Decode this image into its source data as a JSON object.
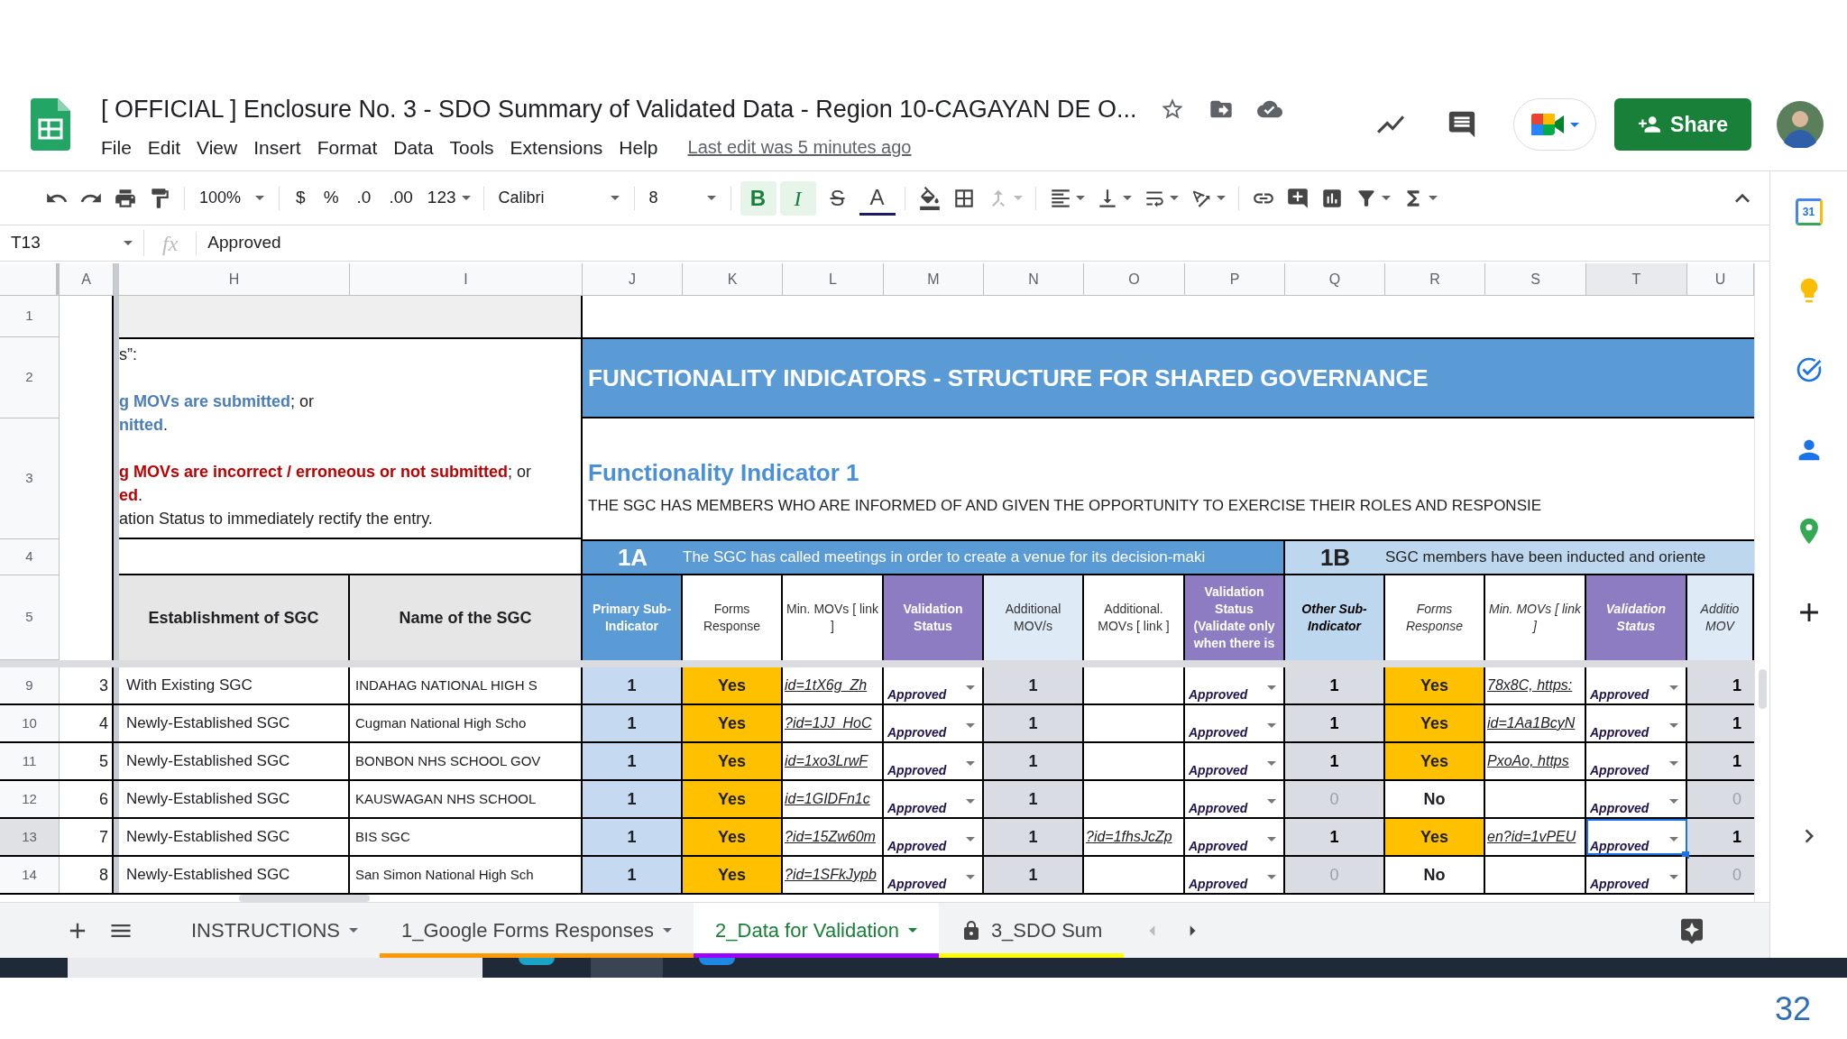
{
  "document": {
    "title": "[ OFFICIAL ] Enclosure No. 3 - SDO Summary of Validated Data - Region 10-CAGAYAN DE O...",
    "last_edit": "Last edit was 5 minutes ago",
    "share": "Share"
  },
  "menu": [
    "File",
    "Edit",
    "View",
    "Insert",
    "Format",
    "Data",
    "Tools",
    "Extensions",
    "Help"
  ],
  "toolbar": {
    "zoom": "100%",
    "currency": "$",
    "percent": "%",
    "decrease_decimals": ".0",
    "increase_decimals": ".00",
    "number_format": "123",
    "font": "Calibri",
    "font_size": "8",
    "styles": [
      {
        "kind": "bold",
        "label": "B",
        "on": true
      },
      {
        "kind": "italic",
        "label": "I",
        "on": true
      },
      {
        "kind": "strike",
        "label": "S",
        "on": false
      }
    ],
    "text_color": "A"
  },
  "formula_bar": {
    "cell": "T13",
    "label": "fx",
    "value": "Approved"
  },
  "columns": [
    {
      "label": "A",
      "selected": false
    },
    {
      "label": "H",
      "selected": false
    },
    {
      "label": "I",
      "selected": false
    },
    {
      "label": "J",
      "selected": false
    },
    {
      "label": "K",
      "selected": false
    },
    {
      "label": "L",
      "selected": false
    },
    {
      "label": "M",
      "selected": false
    },
    {
      "label": "N",
      "selected": false
    },
    {
      "label": "O",
      "selected": false
    },
    {
      "label": "P",
      "selected": false
    },
    {
      "label": "Q",
      "selected": false
    },
    {
      "label": "R",
      "selected": false
    },
    {
      "label": "S",
      "selected": false
    },
    {
      "label": "T",
      "selected": true
    },
    {
      "label": "U",
      "selected": false
    }
  ],
  "top_rows": [
    "1",
    "2",
    "3",
    "4",
    "5"
  ],
  "instructions": [
    {
      "lines": [
        [
          {
            "text": "s”:",
            "kind": "plain"
          }
        ]
      ]
    },
    {
      "lines": [
        [
          {
            "text": "g MOVs are submitted",
            "kind": "ok"
          },
          {
            "text": "; or",
            "kind": "plain"
          }
        ],
        [
          {
            "text": "nitted",
            "kind": "ok"
          },
          {
            "text": ".",
            "kind": "plain"
          }
        ]
      ]
    },
    {
      "lines": [
        [
          {
            "text": "g MOVs are incorrect / erroneous or not submitted",
            "kind": "error"
          },
          {
            "text": "; or",
            "kind": "plain"
          }
        ],
        [
          {
            "text": "ed",
            "kind": "error"
          },
          {
            "text": ".",
            "kind": "plain"
          }
        ],
        [
          {
            "text": "ation Status to immediately rectify the entry.",
            "kind": "plain"
          }
        ]
      ]
    }
  ],
  "banner": "FUNCTIONALITY INDICATORS - STRUCTURE FOR SHARED GOVERNANCE",
  "indicator": {
    "title": "Functionality Indicator 1",
    "description": "THE SGC HAS MEMBERS WHO ARE INFORMED OF AND GIVEN THE OPPORTUNITY TO EXERCISE THEIR ROLES AND RESPONSIE"
  },
  "fixed_headers": [
    "Establishment of SGC",
    "Name of the SGC"
  ],
  "sections": [
    {
      "code": "1A",
      "text": "The SGC has called meetings in order to create a venue for its decision-maki",
      "kind": "primary",
      "italic": false,
      "headers": [
        {
          "text": "Primary Sub-Indicator",
          "kind": "primary"
        },
        {
          "text": "Forms Response",
          "kind": "plain"
        },
        {
          "text": "Min. MOVs [ link ]",
          "kind": "plain"
        },
        {
          "text": "Validation Status",
          "kind": "status"
        },
        {
          "text": "Additional MOV/s",
          "kind": "extra"
        },
        {
          "text": "Additional. MOVs [ link ]",
          "kind": "plain"
        },
        {
          "text": "Validation Status (Validate only when there is",
          "kind": "status"
        }
      ]
    },
    {
      "code": "1B",
      "text": "SGC members have been inducted and oriente",
      "kind": "secondary",
      "italic": true,
      "headers": [
        {
          "text": "Other Sub-Indicator",
          "kind": "secondary"
        },
        {
          "text": "Forms Response",
          "kind": "plain"
        },
        {
          "text": "Min. MOVs [ link ]",
          "kind": "plain"
        },
        {
          "text": "Validation Status",
          "kind": "status"
        },
        {
          "text": "Additio MOV",
          "kind": "extra"
        }
      ]
    }
  ],
  "rows": [
    {
      "row": "9",
      "num": "3",
      "establishment": "With Existing SGC",
      "name": "INDAHAG NATIONAL HIGH S",
      "selected": false,
      "a": {
        "sub": "1",
        "met": true,
        "response": "Yes",
        "mov_link": "id=1tX6g_Zh",
        "status": "Approved",
        "additional": "1",
        "status_2": "Approved"
      },
      "b": {
        "sub": "1",
        "met": true,
        "response": "Yes",
        "mov_link": "78x8C, https:",
        "status": "Approved",
        "additional": "1"
      }
    },
    {
      "row": "10",
      "num": "4",
      "establishment": "Newly-Established SGC",
      "name": "Cugman National High Scho",
      "selected": false,
      "a": {
        "sub": "1",
        "met": true,
        "response": "Yes",
        "mov_link": "?id=1JJ_HoC",
        "status": "Approved",
        "additional": "1",
        "status_2": "Approved"
      },
      "b": {
        "sub": "1",
        "met": true,
        "response": "Yes",
        "mov_link": "id=1Aa1BcyN",
        "status": "Approved",
        "additional": "1"
      }
    },
    {
      "row": "11",
      "num": "5",
      "establishment": "Newly-Established SGC",
      "name": "BONBON NHS SCHOOL GOV",
      "selected": false,
      "a": {
        "sub": "1",
        "met": true,
        "response": "Yes",
        "mov_link": "id=1xo3LrwF",
        "status": "Approved",
        "additional": "1",
        "status_2": "Approved"
      },
      "b": {
        "sub": "1",
        "met": true,
        "response": "Yes",
        "mov_link": "PxoAo, https",
        "status": "Approved",
        "additional": "1"
      }
    },
    {
      "row": "12",
      "num": "6",
      "establishment": "Newly-Established SGC",
      "name": "KAUSWAGAN NHS SCHOOL",
      "selected": false,
      "a": {
        "sub": "1",
        "met": true,
        "response": "Yes",
        "mov_link": "id=1GIDFn1c",
        "status": "Approved",
        "additional": "1",
        "status_2": "Approved"
      },
      "b": {
        "sub": "0",
        "met": false,
        "response": "No",
        "status": "Approved",
        "additional": "0"
      }
    },
    {
      "row": "13",
      "num": "7",
      "establishment": "Newly-Established SGC",
      "name": "BIS SGC",
      "selected": true,
      "a": {
        "sub": "1",
        "met": true,
        "response": "Yes",
        "mov_link": "?id=15Zw60m",
        "status": "Approved",
        "additional": "1",
        "additional_link": "?id=1fhsJcZp",
        "status_2": "Approved"
      },
      "b": {
        "sub": "1",
        "met": true,
        "response": "Yes",
        "mov_link": "en?id=1vPEU",
        "status": "Approved",
        "additional": "1"
      }
    },
    {
      "row": "14",
      "num": "8",
      "establishment": "Newly-Established SGC",
      "name": "San Simon National High Sch",
      "selected": false,
      "a": {
        "sub": "1",
        "met": true,
        "response": "Yes",
        "mov_link": "?id=1SFkJypb",
        "status": "Approved",
        "additional": "1",
        "status_2": "Approved"
      },
      "b": {
        "sub": "0",
        "met": false,
        "response": "No",
        "status": "Approved",
        "additional": "0"
      }
    }
  ],
  "sheet_tabs": [
    {
      "label": "INSTRUCTIONS",
      "selected": false,
      "locked": false
    },
    {
      "label": "1_Google Forms Responses",
      "selected": false,
      "locked": false,
      "color": "#ff9900"
    },
    {
      "label": "2_Data for Validation",
      "selected": true,
      "locked": false,
      "color": "#9900ff"
    },
    {
      "label": "3_SDO Sum",
      "selected": false,
      "locked": true,
      "color": "#ffff00"
    }
  ],
  "side_panel": {
    "calendar_day": "31"
  },
  "slide_number": "32"
}
